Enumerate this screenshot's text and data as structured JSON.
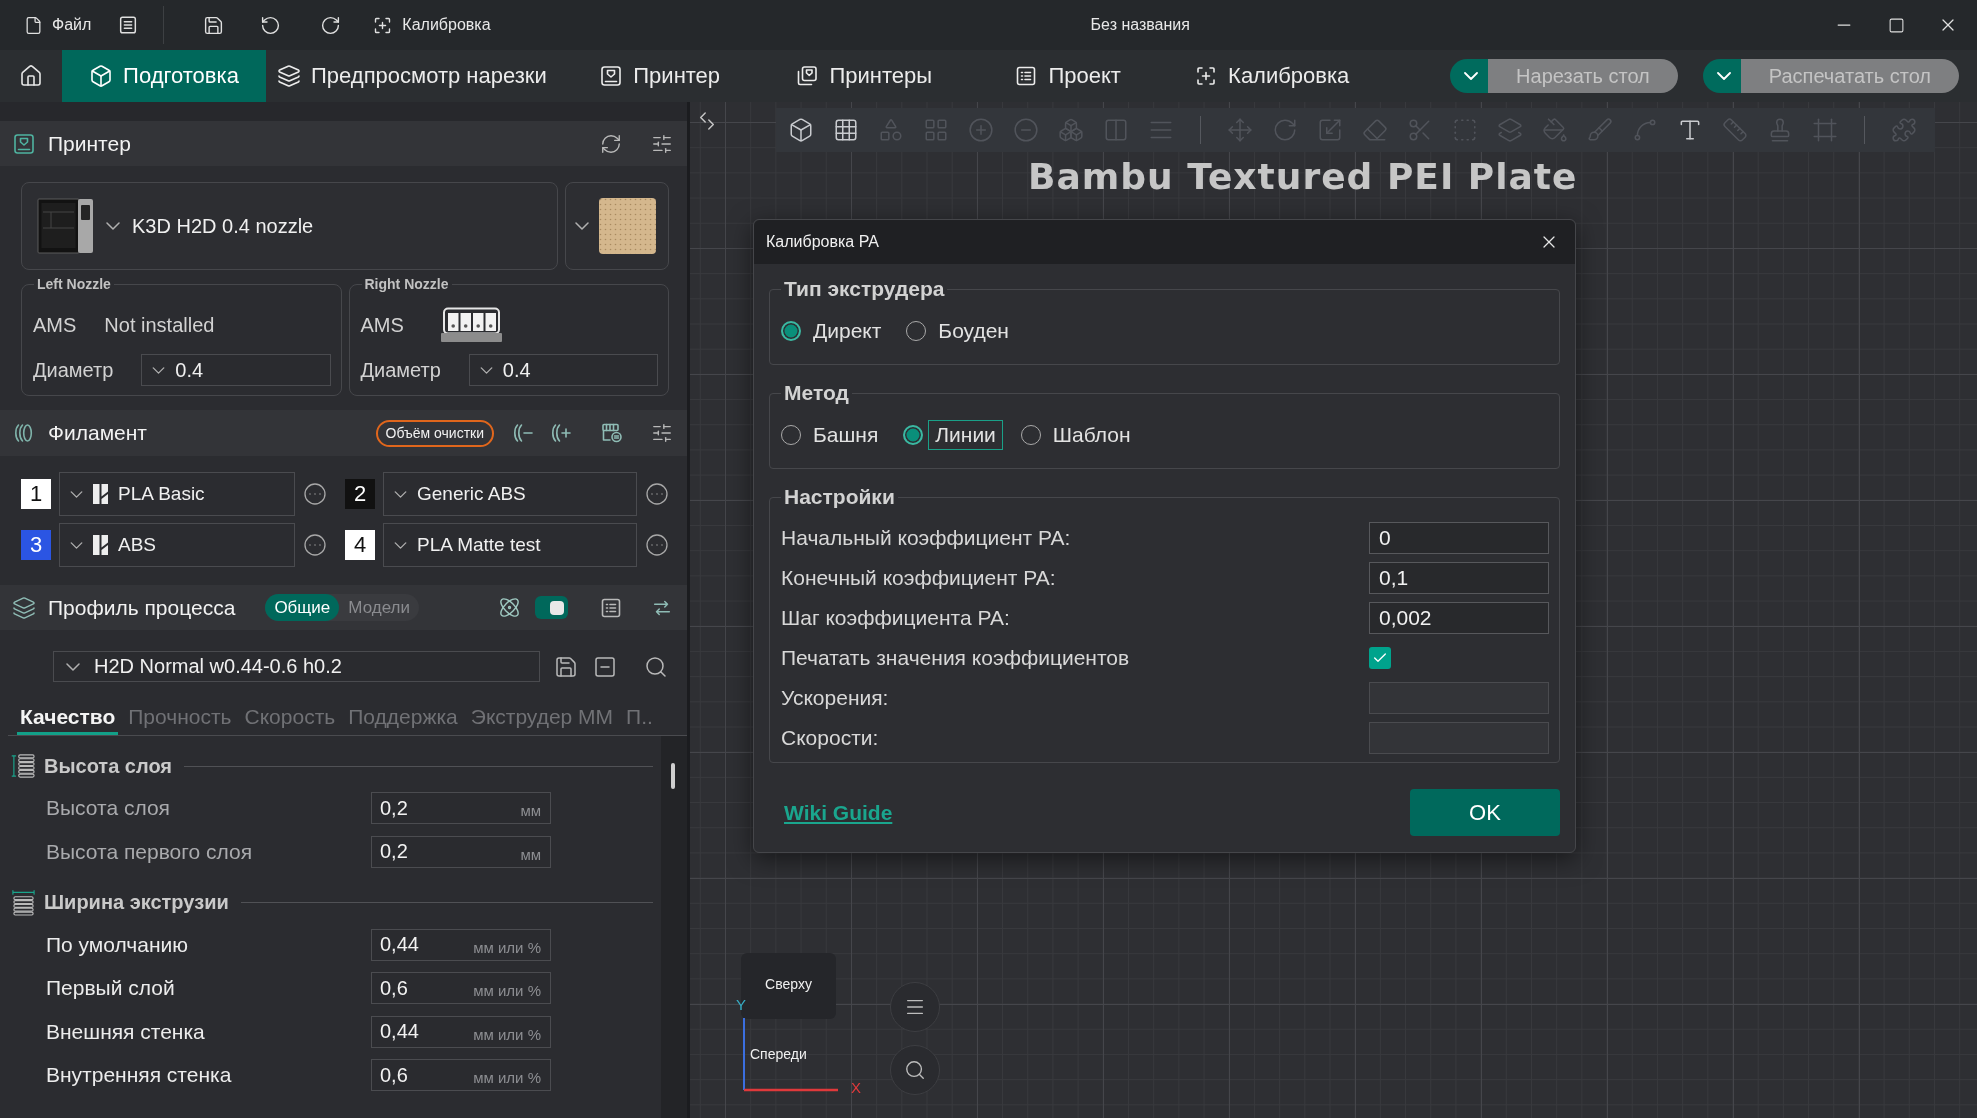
{
  "title_bar": {
    "file_menu": "Файл",
    "calibration": "Калибровка",
    "title": "Без названия"
  },
  "tabs": [
    {
      "label": "Подготовка",
      "selected": true
    },
    {
      "label": "Предпросмотр нарезки",
      "selected": false
    },
    {
      "label": "Принтер",
      "selected": false
    },
    {
      "label": "Принтеры",
      "selected": false
    },
    {
      "label": "Проект",
      "selected": false
    },
    {
      "label": "Калибровка",
      "selected": false
    }
  ],
  "actions": [
    {
      "label": "Нарезать стол",
      "disabled": true
    },
    {
      "label": "Распечатать стол",
      "disabled": true
    }
  ],
  "printer": {
    "title": "Принтер",
    "name": "K3D H2D 0.4 nozzle",
    "nozzles": [
      {
        "title": "Left Nozzle",
        "ams_label": "AMS",
        "ams_installed": false,
        "ams_status": "Not installed",
        "diameter_label": "Диаметр",
        "diameter": "0.4"
      },
      {
        "title": "Right Nozzle",
        "ams_label": "AMS",
        "ams_installed": true,
        "diameter_label": "Диаметр",
        "diameter": "0.4"
      }
    ]
  },
  "filament": {
    "title": "Филамент",
    "purge_button": "Объём очистки",
    "slots": [
      {
        "number": "1",
        "name": "PLA Basic",
        "color": "#ffffff",
        "logo": true
      },
      {
        "number": "2",
        "name": "Generic ABS",
        "color": "#111111",
        "logo": false
      },
      {
        "number": "3",
        "name": "ABS",
        "color": "#2b55e3",
        "logo": true
      },
      {
        "number": "4",
        "name": "PLA Matte test",
        "color": "#ffffff",
        "logo": false
      }
    ]
  },
  "process": {
    "title": "Профиль процесса",
    "scope": [
      {
        "label": "Общие",
        "selected": true
      },
      {
        "label": "Модели",
        "selected": false
      }
    ],
    "toggle_on": true,
    "preset": "H2D Normal w0.44-0.6 h0.2",
    "tabs": [
      {
        "label": "Качество",
        "selected": true
      },
      {
        "label": "Прочность",
        "selected": false
      },
      {
        "label": "Скорость",
        "selected": false
      },
      {
        "label": "Поддержка",
        "selected": false
      },
      {
        "label": "Экструдер ММ",
        "selected": false
      },
      {
        "label": "П..",
        "selected": false
      }
    ],
    "groups": [
      {
        "kind": "height",
        "title": "Высота слоя",
        "rows": [
          {
            "label": "Высота слоя",
            "value": "0,2",
            "unit": "мм",
            "dimmed": true
          },
          {
            "label": "Высота первого слоя",
            "value": "0,2",
            "unit": "мм",
            "dimmed": true
          }
        ]
      },
      {
        "kind": "width",
        "title": "Ширина экструзии",
        "rows": [
          {
            "label": "По умолчанию",
            "value": "0,44",
            "unit": "мм или %",
            "dimmed": false
          },
          {
            "label": "Первый слой",
            "value": "0,6",
            "unit": "мм или %",
            "dimmed": false
          },
          {
            "label": "Внешняя стенка",
            "value": "0,44",
            "unit": "мм или %",
            "dimmed": false
          },
          {
            "label": "Внутренняя стенка",
            "value": "0,6",
            "unit": "мм или %",
            "dimmed": false
          }
        ]
      }
    ]
  },
  "dialog": {
    "title": "Калибровка PA",
    "extruder_type": {
      "title": "Тип экструдера",
      "options": [
        {
          "label": "Директ",
          "selected": true,
          "focused": false
        },
        {
          "label": "Боуден",
          "selected": false,
          "focused": false
        }
      ]
    },
    "method": {
      "title": "Метод",
      "options": [
        {
          "label": "Башня",
          "selected": false,
          "focused": false
        },
        {
          "label": "Линии",
          "selected": true,
          "focused": true
        },
        {
          "label": "Шаблон",
          "selected": false,
          "focused": false
        }
      ]
    },
    "settings": {
      "title": "Настройки",
      "rows": [
        {
          "kind": "input",
          "label": "Начальный коэффициент PA:",
          "value": "0",
          "disabled": false
        },
        {
          "kind": "input",
          "label": "Конечный коэффициент PA:",
          "value": "0,1",
          "disabled": false
        },
        {
          "kind": "input",
          "label": "Шаг коэффициента PA:",
          "value": "0,002",
          "disabled": false
        },
        {
          "kind": "checkbox",
          "label": "Печатать значения коэффициентов",
          "checked": true
        },
        {
          "kind": "input",
          "label": "Ускорения:",
          "disabled": true
        },
        {
          "kind": "input",
          "label": "Скорости:",
          "disabled": true
        }
      ]
    },
    "link": "Wiki Guide",
    "ok_button": "OK"
  },
  "viewport": {
    "plate_label": "Bambu Textured PEI Plate",
    "toolbar_groups": [
      {
        "items": [
          {
            "disabled": false
          },
          {
            "disabled": false
          },
          {
            "disabled": true
          },
          {
            "disabled": true
          },
          {
            "disabled": true
          },
          {
            "disabled": true
          },
          {
            "disabled": true
          },
          {
            "disabled": true
          },
          {
            "disabled": true
          }
        ]
      },
      {
        "items": [
          {
            "disabled": true
          },
          {
            "disabled": true
          },
          {
            "disabled": true
          },
          {
            "disabled": true
          },
          {
            "disabled": true
          },
          {
            "disabled": true
          },
          {
            "disabled": true
          },
          {
            "disabled": true
          },
          {
            "disabled": true
          },
          {
            "disabled": true
          },
          {
            "disabled": false
          },
          {
            "disabled": true
          },
          {
            "disabled": true
          },
          {
            "disabled": true
          }
        ]
      },
      {
        "items": [
          {
            "disabled": true
          }
        ]
      }
    ],
    "view_top": "Сверху",
    "view_front": "Спереди",
    "axis_y": "Y",
    "axis_x": "X"
  }
}
